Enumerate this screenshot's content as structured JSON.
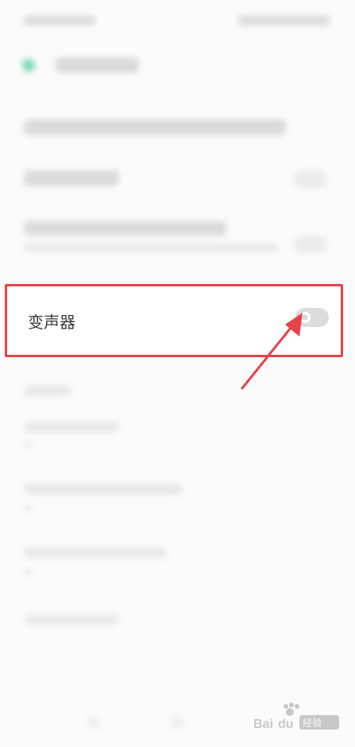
{
  "setting_item": {
    "label": "变声器",
    "toggle_state": "off"
  },
  "highlight": {
    "color": "#e44449"
  },
  "background": {
    "accent_color": "#35c58a"
  },
  "watermark": {
    "brand": "Baidu 经验"
  }
}
